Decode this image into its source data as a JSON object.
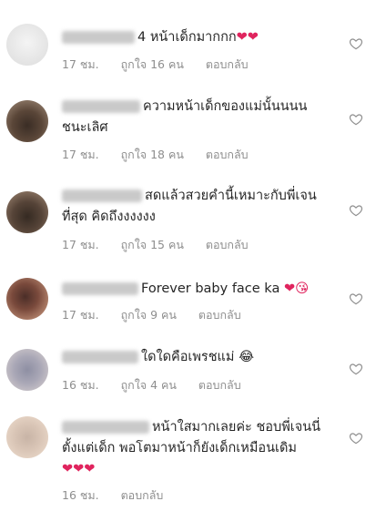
{
  "comments": [
    {
      "text": "4 หน้าเด็กมากกก",
      "emoji": "❤❤",
      "time": "17 ชม.",
      "likes": "ถูกใจ 16 คน",
      "reply": "ตอบกลับ"
    },
    {
      "text": "ความหน้าเด็กของแม่นั้นนนน ชนะเลิศ",
      "emoji": "",
      "time": "17 ชม.",
      "likes": "ถูกใจ 18 คน",
      "reply": "ตอบกลับ"
    },
    {
      "text": "สดแล้วสวยคำนี้เหมาะกับพี่เจนที่สุด คิดถึงงงงงง",
      "emoji": "",
      "time": "17 ชม.",
      "likes": "ถูกใจ 15 คน",
      "reply": "ตอบกลับ"
    },
    {
      "text": "Forever baby face ka",
      "emoji": "❤😘",
      "time": "17 ชม.",
      "likes": "ถูกใจ 9 คน",
      "reply": "ตอบกลับ"
    },
    {
      "text": "ใดใดคือเพรชแม่",
      "emoji": "😂",
      "time": "16 ชม.",
      "likes": "ถูกใจ 4 คน",
      "reply": "ตอบกลับ"
    },
    {
      "text": "หน้าใสมากเลยค่ะ ชอบพี่เจนนี่ตั้งแต่เด็ก พอโตมาหน้าก็ยังเด็กเหมือนเดิม",
      "emoji": "❤❤❤",
      "time": "16 ชม.",
      "likes": "",
      "reply": "ตอบกลับ"
    }
  ],
  "colors": {
    "meta": "#8e8e8e",
    "heart": "#e0245e"
  },
  "icons": {
    "like": "heart-outline-icon"
  }
}
